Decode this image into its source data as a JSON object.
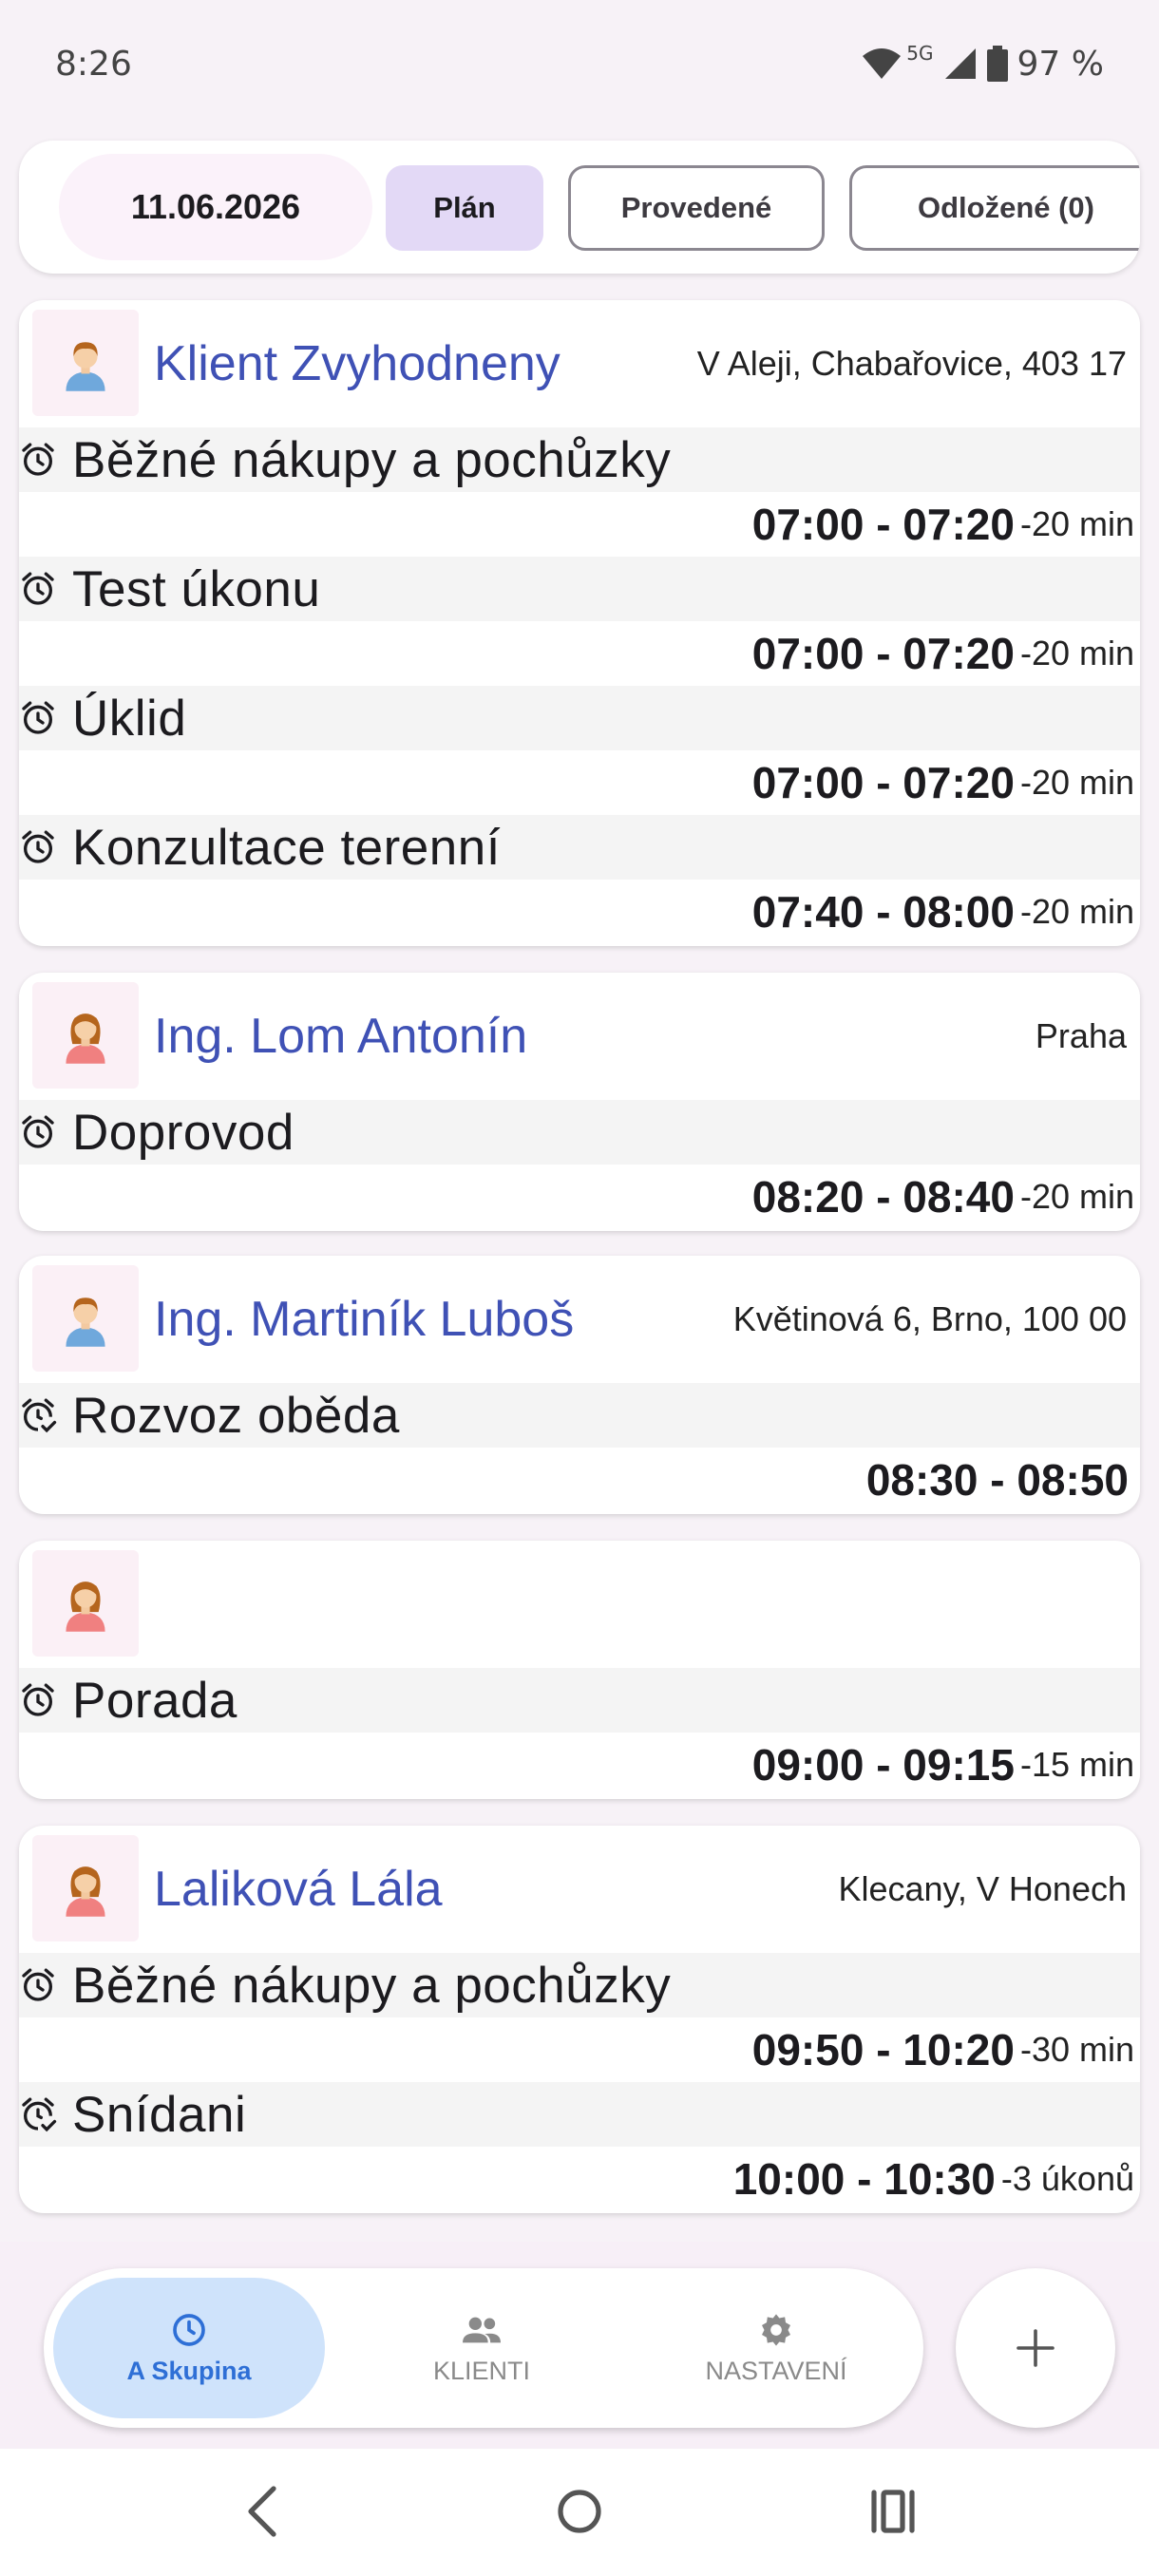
{
  "status_bar": {
    "time": "8:26",
    "network": "5G",
    "battery": "97 %"
  },
  "filter": {
    "date": "11.06.2026",
    "tabs": [
      {
        "label": "Plán",
        "active": true
      },
      {
        "label": "Provedené",
        "active": false
      },
      {
        "label": "Odložené (0)",
        "active": false
      }
    ]
  },
  "cards": [
    {
      "avatar": "male-avatar-icon",
      "name": "Klient Zvyhodneny",
      "address": "V Aleji, Chabařovice, 403 17",
      "tasks": [
        {
          "icon": "alarm-icon",
          "title": "Běžné nákupy a pochůzky",
          "time": "07:00 - 07:20",
          "duration": "-20 min"
        },
        {
          "icon": "alarm-icon",
          "title": "Test úkonu",
          "time": "07:00 - 07:20",
          "duration": "-20 min"
        },
        {
          "icon": "alarm-icon",
          "title": "Úklid",
          "time": "07:00 - 07:20",
          "duration": "-20 min"
        },
        {
          "icon": "alarm-icon",
          "title": "Konzultace terenní",
          "time": "07:40 - 08:00",
          "duration": "-20 min"
        }
      ]
    },
    {
      "avatar": "female-avatar-icon",
      "name": "Ing. Lom Antonín",
      "address": "Praha",
      "tasks": [
        {
          "icon": "alarm-icon",
          "title": "Doprovod",
          "time": "08:20 - 08:40",
          "duration": "-20 min"
        }
      ]
    },
    {
      "avatar": "male-avatar-icon",
      "name": "Ing. Martiník Luboš",
      "address": "Květinová 6, Brno, 100 00",
      "tasks": [
        {
          "icon": "alarm-check-icon",
          "title": "Rozvoz oběda",
          "time": "08:30 - 08:50",
          "duration": ""
        }
      ]
    },
    {
      "avatar": "female-avatar-icon",
      "name": "",
      "address": "",
      "tasks": [
        {
          "icon": "alarm-icon",
          "title": "Porada",
          "time": "09:00 - 09:15",
          "duration": "-15 min"
        }
      ]
    },
    {
      "avatar": "female-avatar-icon",
      "name": "Laliková Lála",
      "address": "Klecany, V Honech",
      "tasks": [
        {
          "icon": "alarm-icon",
          "title": "Běžné nákupy a pochůzky",
          "time": "09:50 - 10:20",
          "duration": "-30 min"
        },
        {
          "icon": "alarm-check-icon",
          "title": "Snídani",
          "time": "10:00 - 10:30",
          "duration": "-3 úkonů"
        }
      ]
    }
  ],
  "bottom_nav": {
    "items": [
      {
        "label": "A Skupina",
        "icon": "clock-icon",
        "active": true
      },
      {
        "label": "KLIENTI",
        "icon": "people-icon",
        "active": false
      },
      {
        "label": "NASTAVENÍ",
        "icon": "gear-icon",
        "active": false
      }
    ],
    "fab_icon": "plus-icon"
  },
  "colors": {
    "accent_name": "#3f51b5",
    "active_tab": "#e3d9f6",
    "nav_active": "#cfe3fb"
  }
}
